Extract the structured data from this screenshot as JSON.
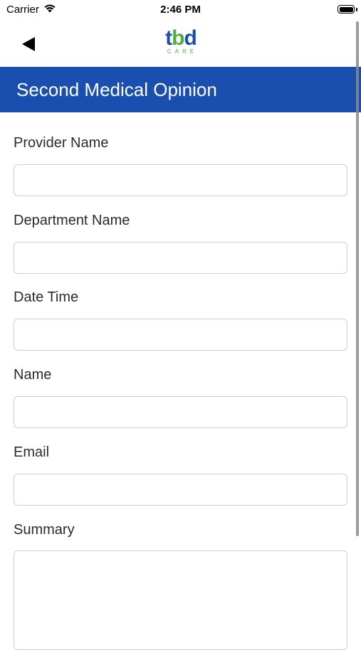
{
  "status_bar": {
    "carrier": "Carrier",
    "time": "2:46 PM"
  },
  "nav": {
    "logo_text_part1": "t",
    "logo_text_part2": "b",
    "logo_text_part3": "d",
    "logo_sub": "CARE"
  },
  "header": {
    "title": "Second Medical Opinion"
  },
  "form": {
    "fields": [
      {
        "label": "Provider Name",
        "value": "",
        "placeholder": ""
      },
      {
        "label": "Department Name",
        "value": "",
        "placeholder": ""
      },
      {
        "label": "Date Time",
        "value": "",
        "placeholder": ""
      },
      {
        "label": "Name",
        "value": "",
        "placeholder": ""
      },
      {
        "label": "Email",
        "value": "",
        "placeholder": ""
      },
      {
        "label": "Summary",
        "value": "",
        "placeholder": ""
      }
    ]
  },
  "colors": {
    "brand_blue": "#1a4fb0",
    "brand_green": "#4caf3a"
  },
  "icons": {
    "back": "back-arrow-icon",
    "wifi": "wifi-icon",
    "battery": "battery-icon"
  }
}
